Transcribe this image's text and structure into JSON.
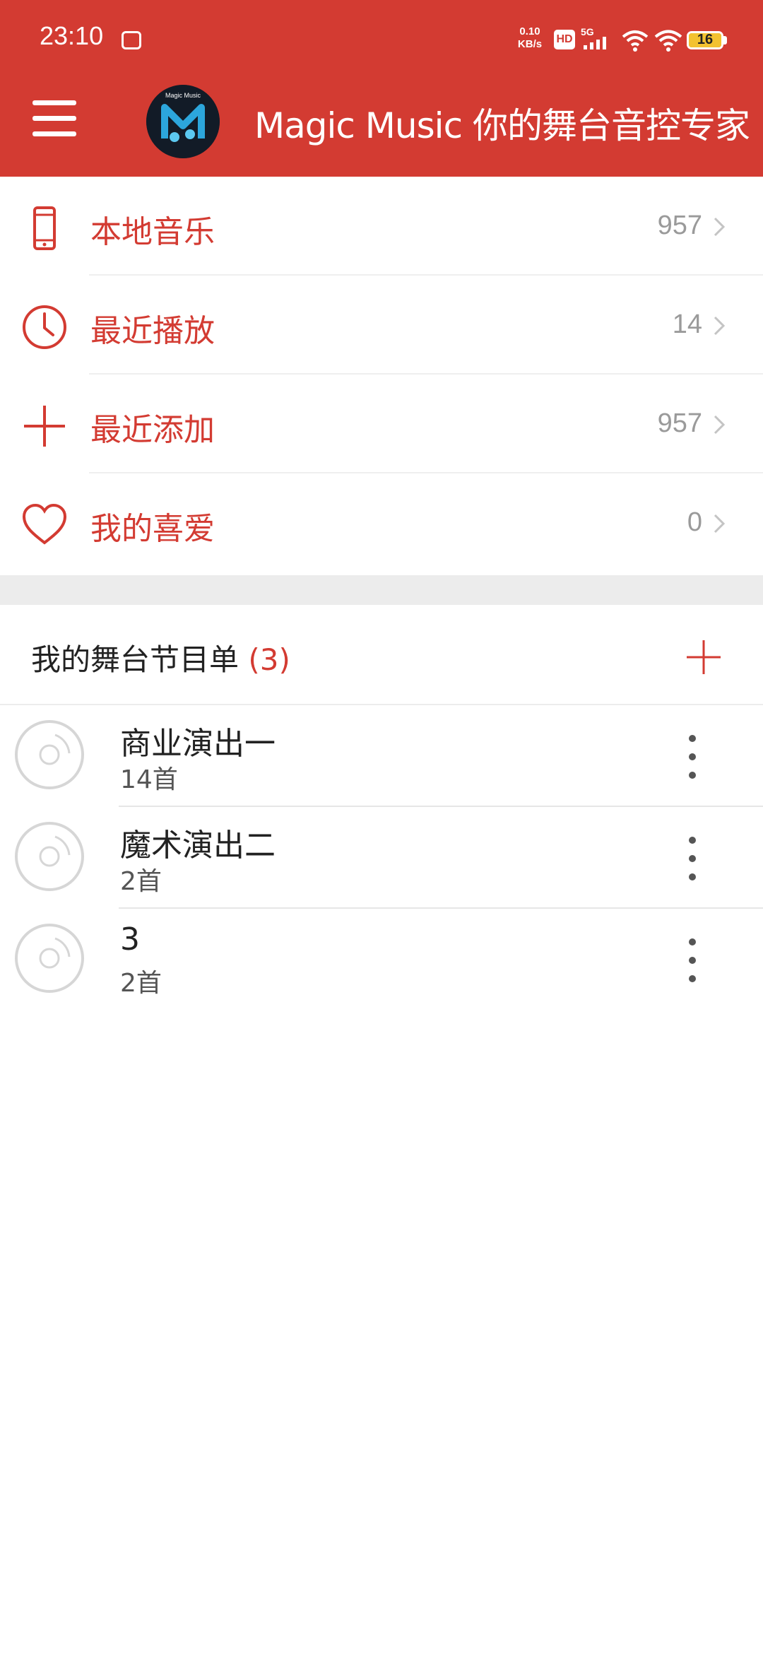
{
  "status_bar": {
    "time": "23:10",
    "net_speed_line1": "0.10",
    "net_speed_line2": "KB/s",
    "hd": "HD",
    "network": "5G",
    "battery": "16"
  },
  "header": {
    "title": "Magic Music 你的舞台音控专家",
    "logo_text": "Magic Music"
  },
  "menu": [
    {
      "label": "本地音乐",
      "count": "957",
      "icon": "phone-icon"
    },
    {
      "label": "最近播放",
      "count": "14",
      "icon": "clock-icon"
    },
    {
      "label": "最近添加",
      "count": "957",
      "icon": "plus-icon"
    },
    {
      "label": "我的喜爱",
      "count": "0",
      "icon": "heart-icon"
    }
  ],
  "playlists_section": {
    "title": "我的舞台节目单",
    "count": "(3)"
  },
  "playlists": [
    {
      "name": "商业演出一",
      "songs": "14首"
    },
    {
      "name": "魔术演出二",
      "songs": "2首"
    },
    {
      "name": "3",
      "songs": "2首"
    }
  ],
  "colors": {
    "accent": "#D33B32",
    "divider_band": "#ECECEC"
  }
}
